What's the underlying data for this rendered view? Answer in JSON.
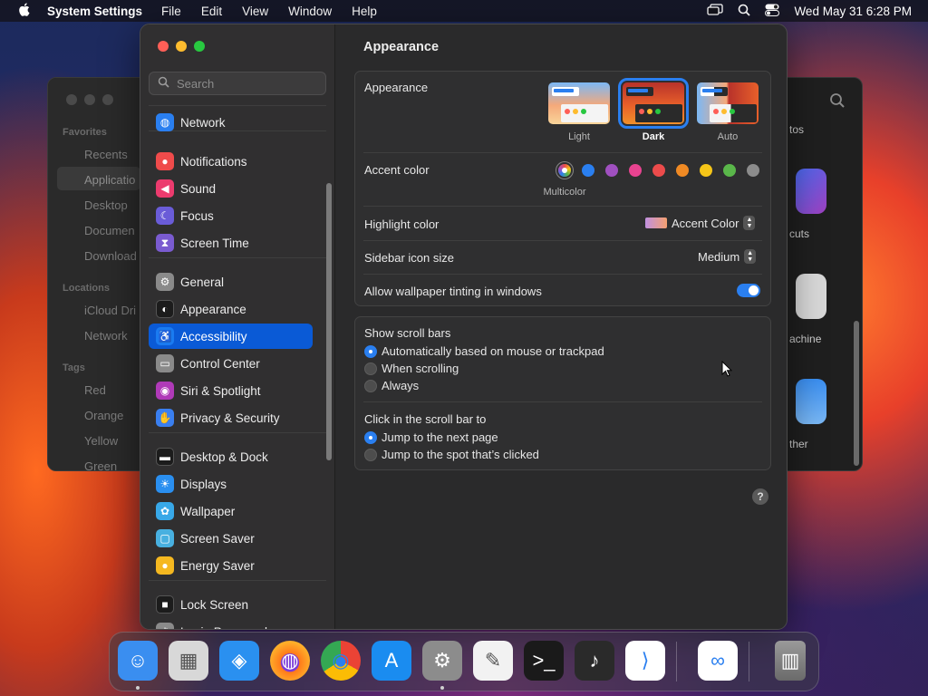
{
  "menubar": {
    "app": "System Settings",
    "items": [
      "File",
      "Edit",
      "View",
      "Window",
      "Help"
    ],
    "clock": "Wed May 31  6:28 PM"
  },
  "finder": {
    "favorites_header": "Favorites",
    "favorites": [
      "Recents",
      "Applicatio",
      "Desktop",
      "Documen",
      "Download"
    ],
    "locations_header": "Locations",
    "locations": [
      "iCloud Dri",
      "Network"
    ],
    "tags_header": "Tags",
    "tags": [
      "Red",
      "Orange",
      "Yellow",
      "Green"
    ],
    "right_labels": [
      "tos",
      "cuts",
      "achine",
      "ther"
    ]
  },
  "sidebar": {
    "search_placeholder": "Search",
    "items": [
      {
        "label": "Network",
        "icon": "globe-icon",
        "color": "#2a7ff0"
      },
      {
        "label": "Notifications",
        "icon": "bell-icon",
        "color": "#ef4b4b"
      },
      {
        "label": "Sound",
        "icon": "speaker-icon",
        "color": "#ec3b6e"
      },
      {
        "label": "Focus",
        "icon": "moon-icon",
        "color": "#6a5cd8"
      },
      {
        "label": "Screen Time",
        "icon": "hourglass-icon",
        "color": "#7a5bd0"
      },
      {
        "label": "General",
        "icon": "gear-icon",
        "color": "#8a8a8a"
      },
      {
        "label": "Appearance",
        "icon": "appearance-icon",
        "color": "#1c1c1c"
      },
      {
        "label": "Accessibility",
        "icon": "accessibility-icon",
        "color": "#1a7bf0"
      },
      {
        "label": "Control Center",
        "icon": "switches-icon",
        "color": "#8a8a8a"
      },
      {
        "label": "Siri & Spotlight",
        "icon": "siri-icon",
        "color": "#b03ab8"
      },
      {
        "label": "Privacy & Security",
        "icon": "hand-icon",
        "color": "#3a7ff0"
      },
      {
        "label": "Desktop & Dock",
        "icon": "dock-icon",
        "color": "#1c1c1c"
      },
      {
        "label": "Displays",
        "icon": "sun-icon",
        "color": "#2a8ff0"
      },
      {
        "label": "Wallpaper",
        "icon": "flower-icon",
        "color": "#38a8e8"
      },
      {
        "label": "Screen Saver",
        "icon": "screensaver-icon",
        "color": "#48b0e0"
      },
      {
        "label": "Energy Saver",
        "icon": "bulb-icon",
        "color": "#f5b820"
      },
      {
        "label": "Lock Screen",
        "icon": "lock-icon",
        "color": "#1c1c1c"
      },
      {
        "label": "Login Password",
        "icon": "key-icon",
        "color": "#8a8a8a"
      }
    ],
    "active": "Accessibility"
  },
  "main": {
    "title": "Appearance",
    "appearance_label": "Appearance",
    "modes": [
      "Light",
      "Dark",
      "Auto"
    ],
    "selected_mode": "Dark",
    "accent_label": "Accent color",
    "accent_selected_name": "Multicolor",
    "accent_colors": [
      "#2a7ff0",
      "#a050c0",
      "#e84390",
      "#ec4b4b",
      "#f08a24",
      "#f5c518",
      "#5ab74a",
      "#8c8c8c"
    ],
    "highlight_label": "Highlight color",
    "highlight_value": "Accent Color",
    "icon_size_label": "Sidebar icon size",
    "icon_size_value": "Medium",
    "tinting_label": "Allow wallpaper tinting in windows",
    "tinting_on": true,
    "scroll_label": "Show scroll bars",
    "scroll_options": [
      "Automatically based on mouse or trackpad",
      "When scrolling",
      "Always"
    ],
    "scroll_selected": 0,
    "click_label": "Click in the scroll bar to",
    "click_options": [
      "Jump to the next page",
      "Jump to the spot that’s clicked"
    ],
    "click_selected": 0,
    "help": "?"
  },
  "dock": {
    "apps": [
      {
        "name": "Finder",
        "icon": "finder-icon",
        "color": "#3a8ef0",
        "running": true
      },
      {
        "name": "Launchpad",
        "icon": "launchpad-icon",
        "color": "#d8d8d8",
        "running": false
      },
      {
        "name": "Safari",
        "icon": "safari-icon",
        "color": "#2a90f0",
        "running": false
      },
      {
        "name": "Firefox",
        "icon": "firefox-icon",
        "color": "#ff7a1a",
        "running": false
      },
      {
        "name": "Chrome",
        "icon": "chrome-icon",
        "color": "#ffffff",
        "running": false
      },
      {
        "name": "App Store",
        "icon": "appstore-icon",
        "color": "#1a8cf0",
        "running": false
      },
      {
        "name": "System Settings",
        "icon": "settings-icon",
        "color": "#8c8c8c",
        "running": true
      },
      {
        "name": "TextEdit",
        "icon": "textedit-icon",
        "color": "#f2f2f2",
        "running": false
      },
      {
        "name": "Terminal",
        "icon": "terminal-icon",
        "color": "#1a1a1a",
        "running": false
      },
      {
        "name": "GarageBand",
        "icon": "guitar-icon",
        "color": "#2a2a2a",
        "running": false
      },
      {
        "name": "Visual Studio Code",
        "icon": "vscode-icon",
        "color": "#ffffff",
        "running": false
      },
      {
        "name": "Visual Studio",
        "icon": "visualstudio-icon",
        "color": "#ffffff",
        "running": false
      },
      {
        "name": "Trash",
        "icon": "trash-icon",
        "color": "#8a8a8a",
        "running": false
      }
    ]
  }
}
